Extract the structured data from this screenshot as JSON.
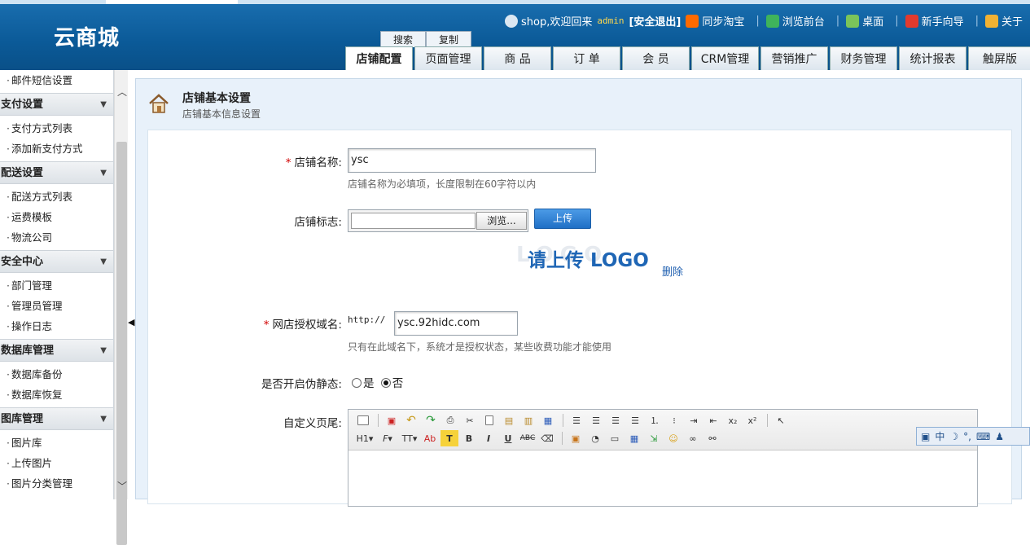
{
  "header": {
    "logo": "云商城",
    "welcome": "shop,欢迎回来",
    "user": "admin",
    "logout": "[安全退出]",
    "links": [
      "同步淘宝",
      "浏览前台",
      "桌面",
      "新手向导",
      "关于"
    ],
    "subtabs": [
      "搜索",
      "复制"
    ],
    "tabs": [
      "店铺配置",
      "页面管理",
      "商 品",
      "订 单",
      "会 员",
      "CRM管理",
      "营销推广",
      "财务管理",
      "统计报表",
      "触屏版"
    ]
  },
  "sidebar": {
    "top_item": "邮件短信设置",
    "groups": [
      {
        "title": "支付设置",
        "items": [
          "支付方式列表",
          "添加新支付方式"
        ]
      },
      {
        "title": "配送设置",
        "items": [
          "配送方式列表",
          "运费模板",
          "物流公司"
        ]
      },
      {
        "title": "安全中心",
        "items": [
          "部门管理",
          "管理员管理",
          "操作日志"
        ]
      },
      {
        "title": "数据库管理",
        "items": [
          "数据库备份",
          "数据库恢复"
        ]
      },
      {
        "title": "图库管理",
        "items": [
          "图片库",
          "上传图片",
          "图片分类管理"
        ]
      }
    ]
  },
  "page": {
    "title": "店铺基本设置",
    "subtitle": "店铺基本信息设置"
  },
  "form": {
    "store_name_label": "店铺名称:",
    "store_name_value": "ysc",
    "store_name_hint": "店铺名称为必填项，长度限制在60字符以内",
    "logo_label": "店铺标志:",
    "browse_label": "浏览...",
    "upload_label": "上传",
    "logo_placeholder_text": "请上传 LOGO",
    "delete_label": "删除",
    "domain_label": "网店授权域名:",
    "domain_prefix": "http://",
    "domain_value": "ysc.92hidc.com",
    "domain_hint": "只有在此域名下，系统才是授权状态，某些收费功能才能使用",
    "rewrite_label": "是否开启伪静态:",
    "rewrite_yes": "是",
    "rewrite_no": "否",
    "rewrite_selected": "否",
    "footer_label": "自定义页尾:"
  },
  "ime": {
    "mode": "中"
  }
}
